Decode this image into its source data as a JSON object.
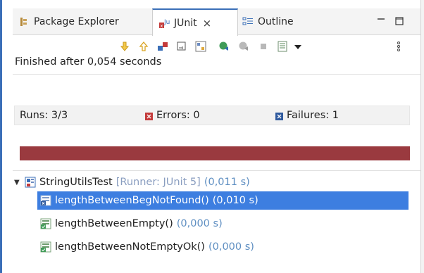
{
  "tabs": [
    {
      "label": "Package Explorer",
      "icon": "package-explorer-icon"
    },
    {
      "label": "JUnit",
      "icon": "junit-icon",
      "active": true
    },
    {
      "label": "Outline",
      "icon": "outline-icon"
    }
  ],
  "close_glyph": "×",
  "toolbar": {
    "buttons": [
      "next-failure-icon",
      "previous-failure-icon",
      "show-failures-only-icon",
      "scroll-lock-icon",
      "show-skipped-tests-icon",
      "rerun-test-icon",
      "rerun-failed-first-icon",
      "stop-icon",
      "test-run-history-icon",
      "view-menu-icon",
      "more-options-icon"
    ]
  },
  "status_text": "Finished after 0,054 seconds",
  "counters": {
    "runs_label": "Runs:",
    "runs_value": "3/3",
    "errors_label": "Errors:",
    "errors_value": "0",
    "failures_label": "Failures:",
    "failures_value": "1"
  },
  "progress": {
    "fraction": 1.0,
    "color": "#9a3a3f",
    "state": "failed"
  },
  "tree": {
    "root": {
      "name": "StringUtilsTest",
      "runner": "[Runner: JUnit 5]",
      "time": "(0,011 s)",
      "expanded": true
    },
    "children": [
      {
        "name": "lengthBetweenBegNotFound()",
        "time": "(0,010 s)",
        "status": "failed",
        "selected": true
      },
      {
        "name": "lengthBetweenEmpty()",
        "time": "(0,000 s)",
        "status": "passed",
        "selected": false
      },
      {
        "name": "lengthBetweenNotEmptyOk()",
        "time": "(0,000 s)",
        "status": "passed",
        "selected": false
      }
    ]
  },
  "colors": {
    "accent": "#3b6fb8",
    "selection": "#3d7ee0",
    "failure": "#9a3a3f",
    "time_text": "#5f8fc2"
  }
}
